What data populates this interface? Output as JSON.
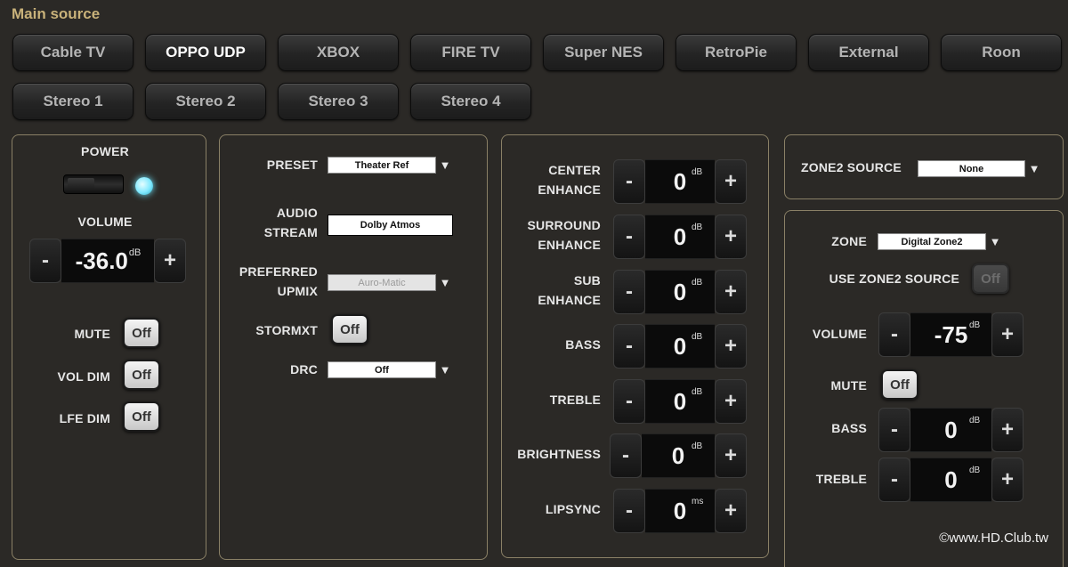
{
  "header": {
    "title": "Main source"
  },
  "sources": {
    "row1": [
      "Cable TV",
      "OPPO UDP",
      "XBOX",
      "FIRE TV",
      "Super NES",
      "RetroPie",
      "External",
      "Roon"
    ],
    "row2": [
      "Stereo 1",
      "Stereo 2",
      "Stereo 3",
      "Stereo 4"
    ],
    "active": "OPPO UDP"
  },
  "main_panel": {
    "power_label": "POWER",
    "volume_label": "VOLUME",
    "volume_value": "-36.0",
    "volume_unit": "dB",
    "minus": "-",
    "plus": "+",
    "mute_label": "MUTE",
    "mute_value": "Off",
    "voldim_label": "VOL DIM",
    "voldim_value": "Off",
    "lfedim_label": "LFE DIM",
    "lfedim_value": "Off"
  },
  "audio_panel": {
    "preset_label": "PRESET",
    "preset_value": "Theater Ref",
    "audio_stream_label_1": "AUDIO",
    "audio_stream_label_2": "STREAM",
    "audio_stream_value": "Dolby Atmos",
    "upmix_label_1": "PREFERRED",
    "upmix_label_2": "UPMIX",
    "upmix_value": "Auro-Matic",
    "stormxt_label": "STORMXT",
    "stormxt_value": "Off",
    "drc_label": "DRC",
    "drc_value": "Off"
  },
  "tone_panel": {
    "center_1": "CENTER",
    "center_2": "ENHANCE",
    "center_value": "0",
    "surround_1": "SURROUND",
    "surround_2": "ENHANCE",
    "surround_value": "0",
    "sub_1": "SUB",
    "sub_2": "ENHANCE",
    "sub_value": "0",
    "bass_label": "BASS",
    "bass_value": "0",
    "treble_label": "TREBLE",
    "treble_value": "0",
    "brightness_label": "BRIGHTNESS",
    "brightness_value": "0",
    "lipsync_label": "LIPSYNC",
    "lipsync_value": "0",
    "db_unit": "dB",
    "ms_unit": "ms"
  },
  "zone2_source": {
    "label": "ZONE2 SOURCE",
    "value": "None"
  },
  "zone_panel": {
    "zone_label": "ZONE",
    "zone_value": "Digital Zone2",
    "use_label": "USE ZONE2 SOURCE",
    "use_value": "Off",
    "volume_label": "VOLUME",
    "volume_value": "-75",
    "mute_label": "MUTE",
    "mute_value": "Off",
    "bass_label": "BASS",
    "bass_value": "0",
    "treble_label": "TREBLE",
    "treble_value": "0",
    "db_unit": "dB"
  },
  "watermark": "©www.HD.Club.tw",
  "colors": {
    "title": "#c9b27a",
    "panel_border": "#8a8066",
    "led": "#7fe9ff"
  },
  "icons": [
    "chevron-down-icon",
    "power-led-icon",
    "power-slider"
  ]
}
